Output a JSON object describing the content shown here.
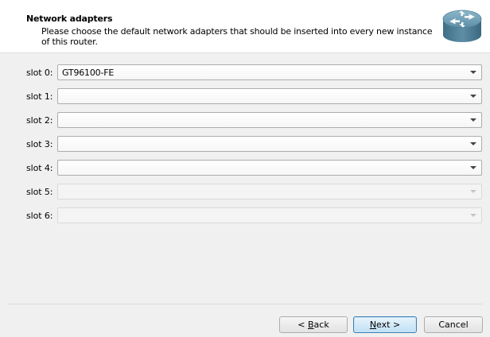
{
  "header": {
    "title": "Network adapters",
    "subtitle": "Please choose the default network adapters that should be inserted into every new instance of this router.",
    "icon": "router-icon"
  },
  "slots": [
    {
      "label": "slot 0:",
      "value": "GT96100-FE",
      "enabled": true
    },
    {
      "label": "slot 1:",
      "value": "",
      "enabled": true
    },
    {
      "label": "slot 2:",
      "value": "",
      "enabled": true
    },
    {
      "label": "slot 3:",
      "value": "",
      "enabled": true
    },
    {
      "label": "slot 4:",
      "value": "",
      "enabled": true
    },
    {
      "label": "slot 5:",
      "value": "",
      "enabled": false
    },
    {
      "label": "slot 6:",
      "value": "",
      "enabled": false
    }
  ],
  "buttons": {
    "back_mnemonic": "B",
    "back_rest": "ack",
    "back_prefix": "< ",
    "next_mnemonic": "N",
    "next_rest": "ext >",
    "cancel": "Cancel"
  },
  "colors": {
    "header_bg": "#ffffff",
    "dialog_bg": "#f0f0f0",
    "primary_border": "#3c7fb1"
  }
}
